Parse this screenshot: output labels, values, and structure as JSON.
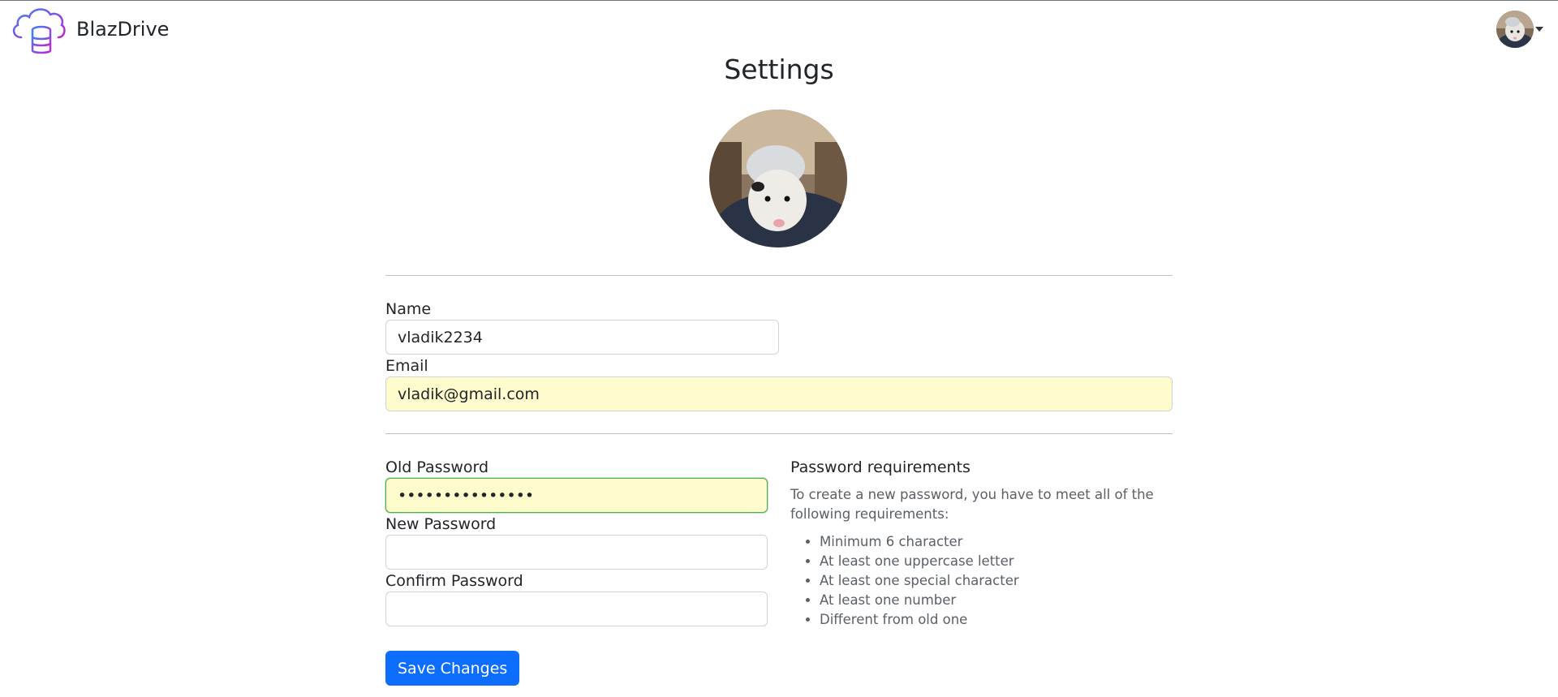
{
  "app": {
    "name": "BlazDrive",
    "logo_icon": "cloud-database-icon"
  },
  "user": {
    "avatar_icon": "possum-avatar-photo"
  },
  "page": {
    "title": "Settings"
  },
  "profile": {
    "name_label": "Name",
    "name_value": "vladik2234",
    "email_label": "Email",
    "email_value": "vladik@gmail.com"
  },
  "password": {
    "old_label": "Old Password",
    "old_value": "•••••••••••••••",
    "new_label": "New Password",
    "new_value": "",
    "confirm_label": "Confirm Password",
    "confirm_value": ""
  },
  "requirements": {
    "title": "Password requirements",
    "intro": "To create a new password, you have to meet all of the following requirements:",
    "items": [
      "Minimum 6 character",
      "At least one uppercase letter",
      "At least one special character",
      "At least one number",
      "Different from old one"
    ]
  },
  "actions": {
    "save_label": "Save Changes"
  },
  "colors": {
    "primary": "#0d6efd",
    "autofill_bg": "#fefbcc",
    "focus_border": "#4caf50",
    "logo_gradient_start": "#3b82f6",
    "logo_gradient_end": "#c026d3"
  }
}
